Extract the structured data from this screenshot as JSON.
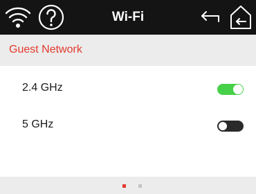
{
  "header": {
    "title": "Wi-Fi",
    "left_icons": [
      "wifi-icon",
      "help-icon"
    ],
    "right_icons": [
      "back-icon",
      "home-icon"
    ]
  },
  "section": {
    "label": "Guest Network"
  },
  "bands": [
    {
      "label": "2.4 GHz",
      "enabled": true
    },
    {
      "label": "5 GHz",
      "enabled": false
    }
  ],
  "pager": {
    "pages": 2,
    "current": 1
  },
  "colors": {
    "header_bg": "#141414",
    "accent": "#e23a2e",
    "toggle_on": "#47d14a",
    "toggle_off": "#2a2a2a",
    "page_bg": "#ececec",
    "panel_bg": "#ffffff",
    "dot_inactive": "#c4c4c4"
  }
}
